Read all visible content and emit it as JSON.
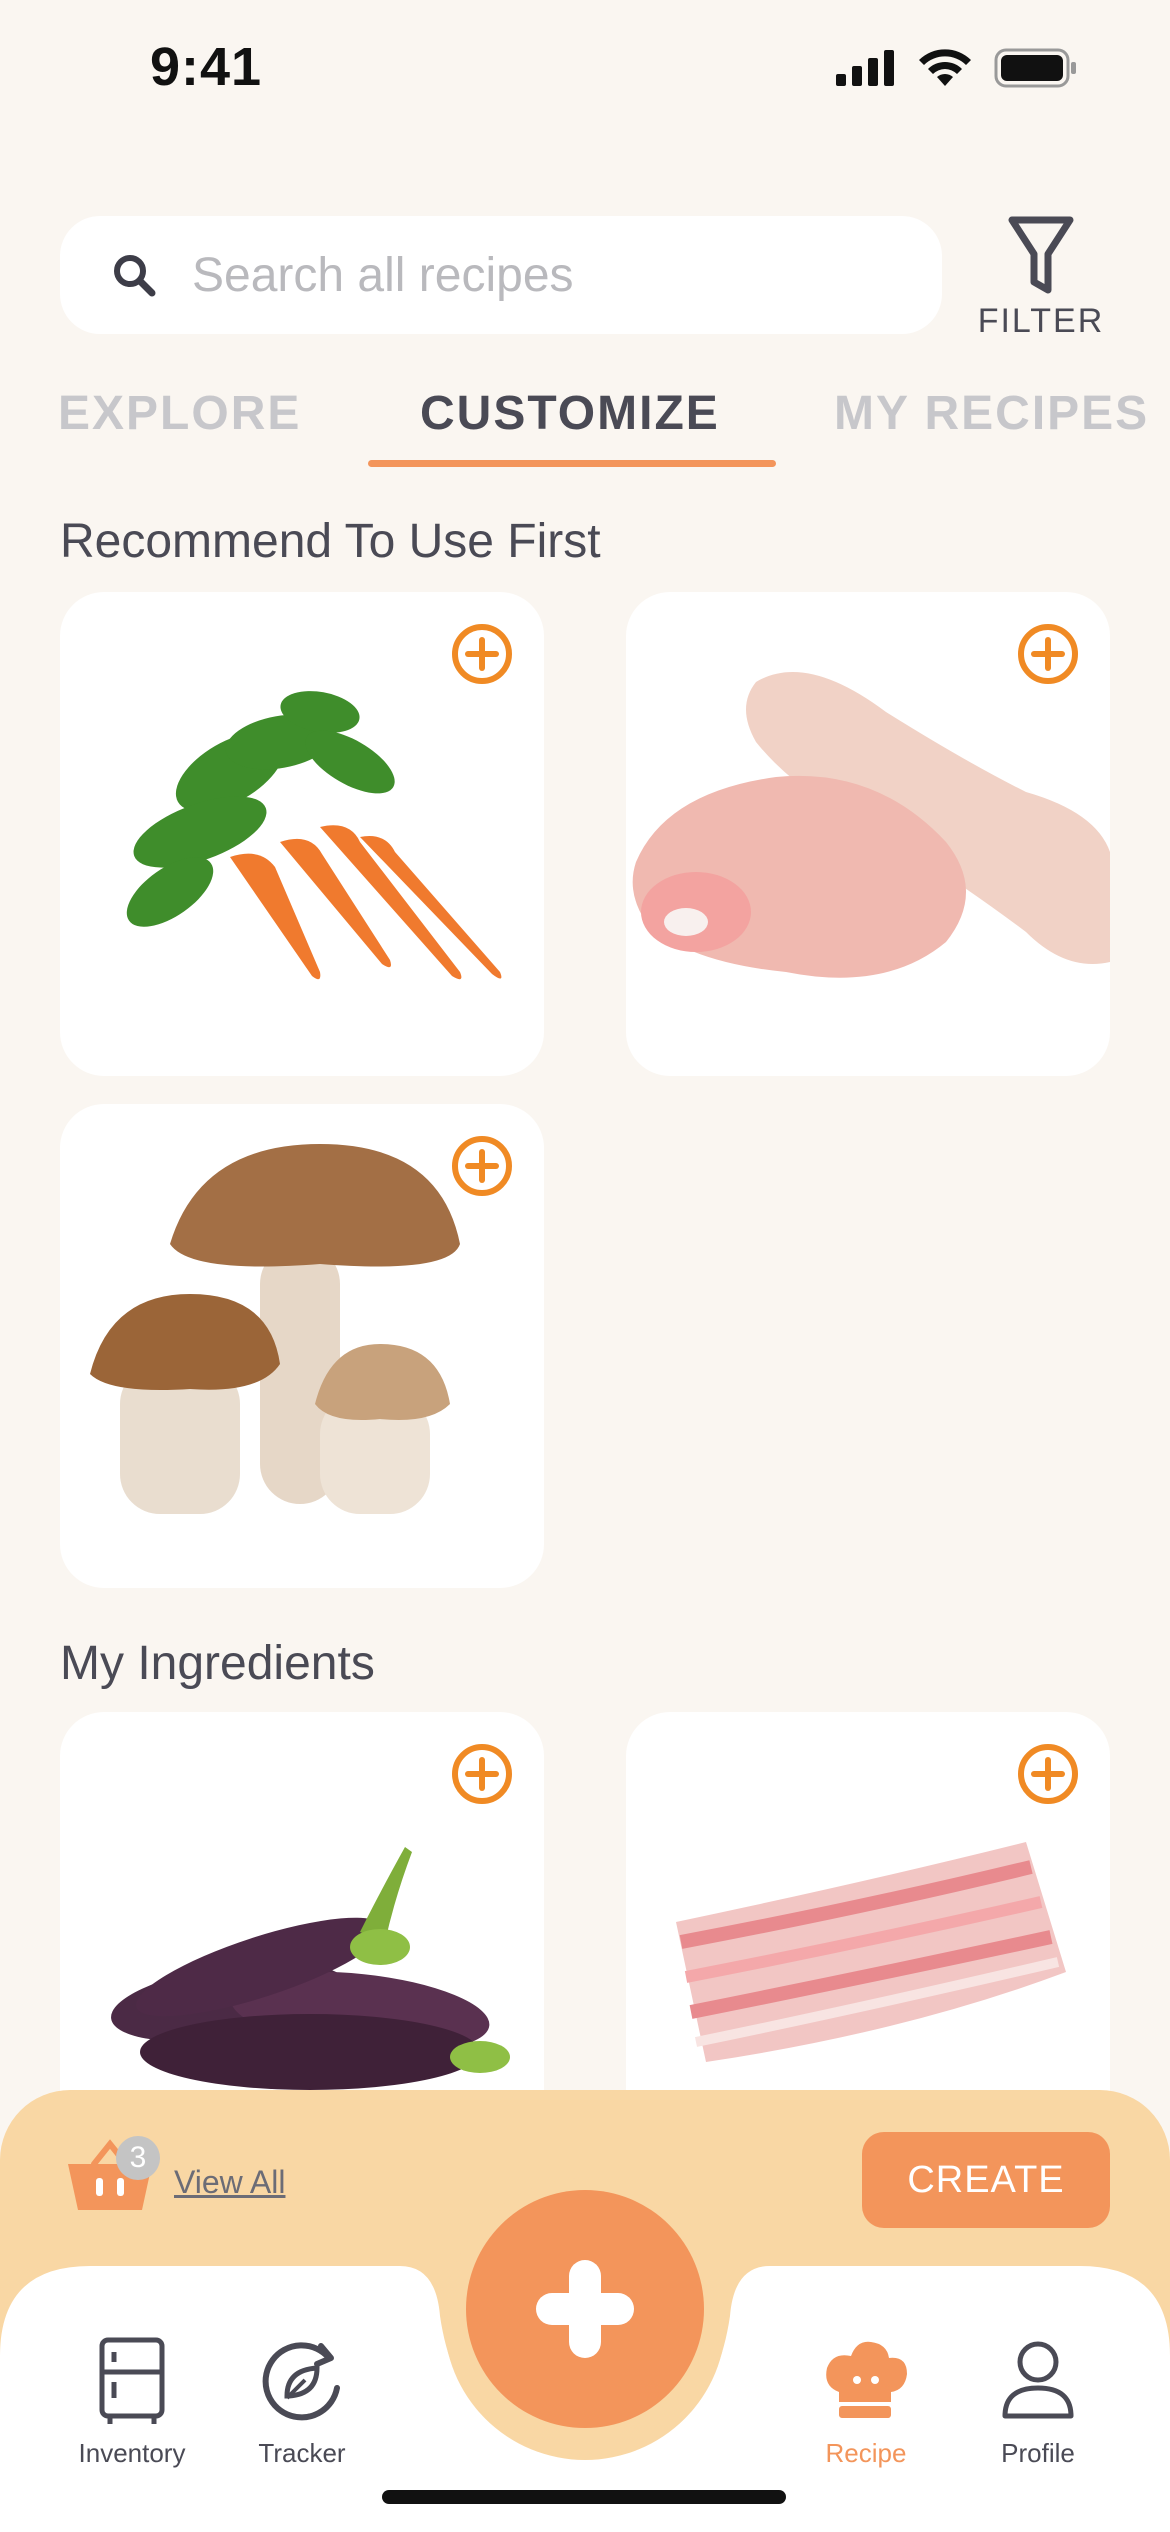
{
  "status": {
    "time": "9:41"
  },
  "search": {
    "placeholder": "Search all recipes",
    "value": ""
  },
  "filter": {
    "label": "FILTER"
  },
  "tabs": [
    {
      "label": "EXPLORE",
      "active": false
    },
    {
      "label": "CUSTOMIZE",
      "active": true
    },
    {
      "label": "MY RECIPES",
      "active": false
    }
  ],
  "sections": {
    "recommend": {
      "title": "Recommend To Use First",
      "items": [
        {
          "icon": "carrot-image"
        },
        {
          "icon": "chicken-drumstick-image"
        },
        {
          "icon": "mushroom-image"
        }
      ]
    },
    "ingredients": {
      "title": "My Ingredients",
      "items": [
        {
          "icon": "eggplant-image"
        },
        {
          "icon": "pork-belly-image"
        }
      ]
    }
  },
  "cart": {
    "count": "3",
    "view_all_label": "View All",
    "create_label": "CREATE"
  },
  "nav": [
    {
      "label": "Inventory",
      "icon": "fridge-icon"
    },
    {
      "label": "Tracker",
      "icon": "leaf-refresh-icon"
    },
    {
      "label": "Recipe",
      "icon": "chef-hat-icon"
    },
    {
      "label": "Profile",
      "icon": "person-icon"
    }
  ],
  "colors": {
    "accent": "#f3955b",
    "panel": "#f9d7a4",
    "background": "#faf6f1",
    "add_icon": "#f08a24"
  }
}
